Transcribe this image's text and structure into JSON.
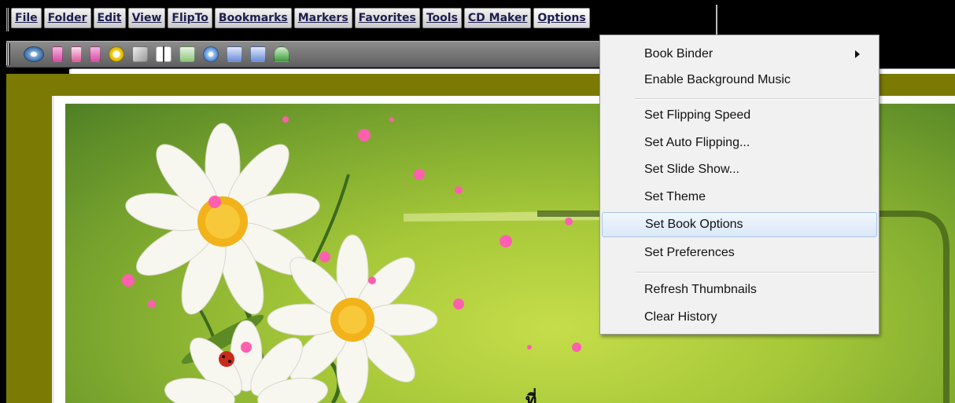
{
  "menubar": {
    "items": [
      "File",
      "Folder",
      "Edit",
      "View",
      "FlipTo",
      "Bookmarks",
      "Markers",
      "Favorites",
      "Tools",
      "CD Maker",
      "Options"
    ]
  },
  "toolbar": {
    "icons": [
      "view-icon",
      "page-icon",
      "book-icon",
      "page-layout-icon",
      "go-to-page-icon",
      "thumbnails-icon",
      "document-icon",
      "add-icon",
      "pen-icon",
      "two-page-icon",
      "tag-icon",
      "book-open-icon",
      "cd-icon",
      "resize-icon",
      "window-icon",
      "panel-icon",
      "tree-icon"
    ]
  },
  "options_menu": {
    "items": {
      "book_binder": "Book Binder",
      "enable_bg_music": "Enable Background Music",
      "set_flipping_speed": "Set Flipping Speed",
      "set_auto_flipping": "Set Auto Flipping...",
      "set_slide_show": "Set Slide Show...",
      "set_theme": "Set Theme",
      "set_book_options": "Set Book Options",
      "set_preferences": "Set Preferences",
      "refresh_thumbnails": "Refresh Thumbnails",
      "clear_history": "Clear History"
    },
    "highlighted": "Set Book Options"
  },
  "colors": {
    "page_background": "#7b7a04",
    "menu_highlight": "#dbe8f7"
  }
}
